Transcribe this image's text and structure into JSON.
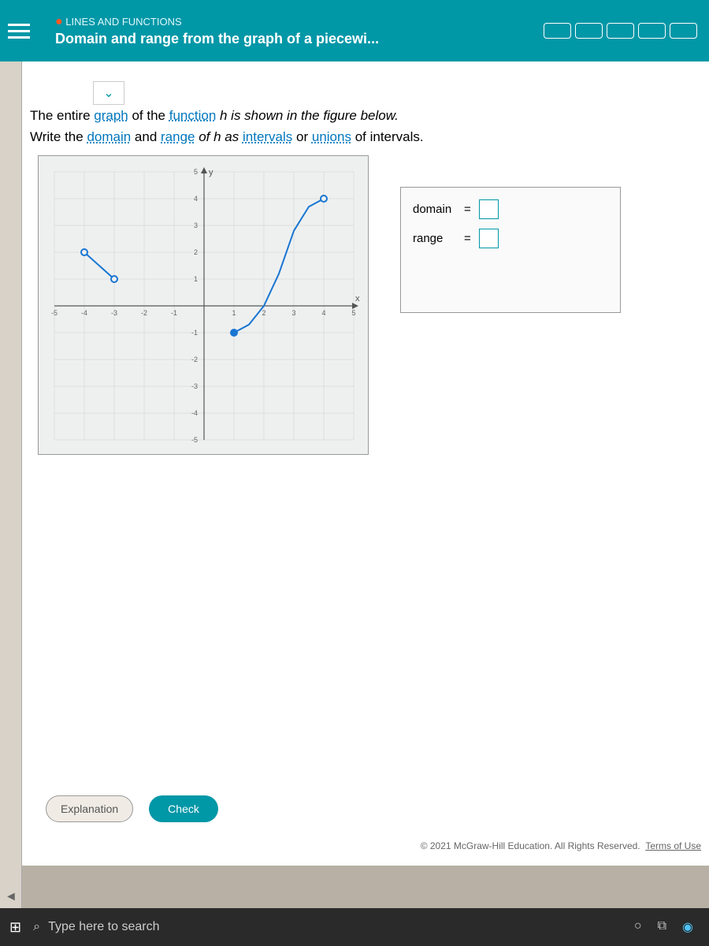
{
  "header": {
    "category": "LINES AND FUNCTIONS",
    "title": "Domain and range from the graph of a piecewi..."
  },
  "prompt": {
    "line1_a": "The entire ",
    "line1_b": "graph",
    "line1_c": " of the ",
    "line1_d": "function",
    "line1_e": " h is shown in the figure below.",
    "line2_a": "Write the ",
    "line2_b": "domain",
    "line2_c": " and ",
    "line2_d": "range",
    "line2_e": " of h as ",
    "line2_f": "intervals",
    "line2_g": " or ",
    "line2_h": "unions",
    "line2_i": " of intervals."
  },
  "answer": {
    "domain_label": "domain",
    "range_label": "range",
    "eq": "="
  },
  "buttons": {
    "explanation": "Explanation",
    "check": "Check"
  },
  "footer": {
    "copyright": "© 2021 McGraw-Hill Education. All Rights Reserved.",
    "tou": "Terms of Use"
  },
  "taskbar": {
    "search_placeholder": "Type here to search"
  },
  "chart_data": {
    "type": "line",
    "xlim": [
      -5,
      5
    ],
    "ylim": [
      -5,
      5
    ],
    "xlabel": "x",
    "ylabel": "y",
    "ticks_x": [
      -5,
      -4,
      -3,
      -2,
      -1,
      1,
      2,
      3,
      4,
      5
    ],
    "ticks_y": [
      -5,
      -4,
      -3,
      -2,
      -1,
      1,
      2,
      3,
      4,
      5
    ],
    "pieces": [
      {
        "points": [
          [
            -4,
            2
          ],
          [
            -3,
            1
          ]
        ],
        "endpoints": [
          {
            "x": -4,
            "y": 2,
            "open": true
          },
          {
            "x": -3,
            "y": 1,
            "open": true
          }
        ]
      },
      {
        "points": [
          [
            1,
            -1
          ],
          [
            1.5,
            -0.7
          ],
          [
            2,
            0
          ],
          [
            2.5,
            1.2
          ],
          [
            3,
            2.8
          ],
          [
            3.5,
            3.7
          ],
          [
            4,
            4
          ]
        ],
        "endpoints": [
          {
            "x": 1,
            "y": -1,
            "open": false
          },
          {
            "x": 4,
            "y": 4,
            "open": true
          }
        ]
      }
    ]
  }
}
